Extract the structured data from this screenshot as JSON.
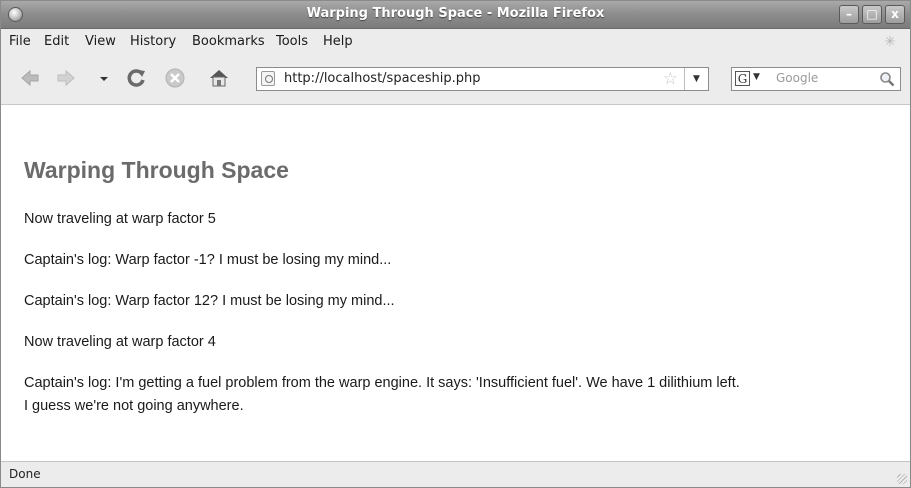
{
  "window": {
    "title": "Warping Through Space - Mozilla Firefox",
    "minimize_glyph": "–",
    "maximize_glyph": "□",
    "close_glyph": "x"
  },
  "menu": {
    "items": [
      {
        "label": "File"
      },
      {
        "label": "Edit"
      },
      {
        "label": "View"
      },
      {
        "label": "History"
      },
      {
        "label": "Bookmarks"
      },
      {
        "label": "Tools"
      },
      {
        "label": "Help"
      }
    ]
  },
  "toolbar": {
    "icons": [
      "back-arrow-icon",
      "forward-arrow-icon",
      "history-dropdown-icon",
      "reload-icon",
      "stop-icon",
      "home-icon"
    ],
    "url": "http://localhost/spaceship.php",
    "search_placeholder": "Google",
    "search_engine_letter": "G"
  },
  "page": {
    "heading": "Warping Through Space",
    "paragraphs": [
      "Now traveling at warp factor 5",
      "Captain's log: Warp factor -1? I must be losing my mind...",
      "Captain's log: Warp factor 12? I must be losing my mind...",
      "Now traveling at warp factor 4",
      "Captain's log: I'm getting a fuel problem from the warp engine. It says: 'Insufficient fuel'. We have 1 dilithium left.",
      "I guess we're not going anywhere."
    ]
  },
  "status": {
    "text": "Done"
  },
  "colors": {
    "titlebar": "#8c8c8c",
    "heading": "#6b6b6b",
    "chrome": "#ececec"
  }
}
